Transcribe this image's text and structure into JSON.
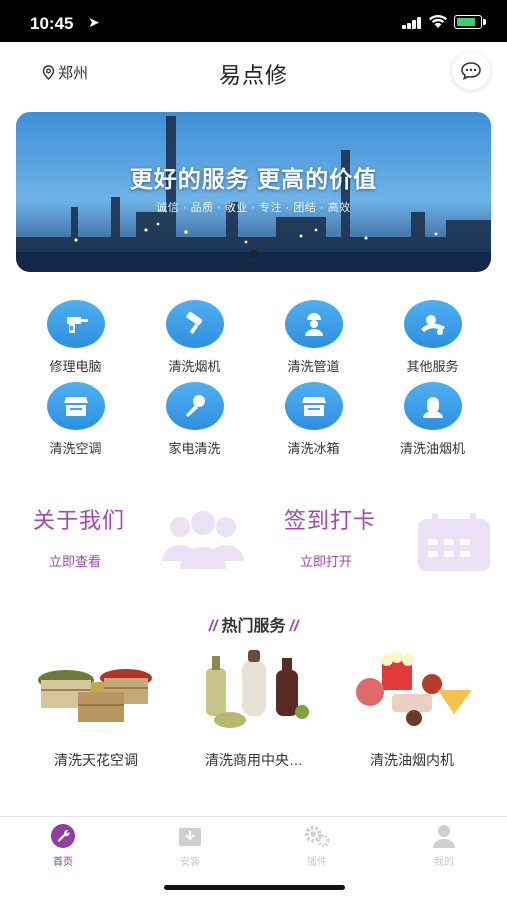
{
  "status_bar": {
    "time": "10:45",
    "location_arrow": "➤",
    "battery_color": "#3cd070"
  },
  "header": {
    "location": "郑州",
    "title": "易点修",
    "location_icon": "location-pin-icon",
    "message_icon": "chat-bubble-icon"
  },
  "banner": {
    "title": "更好的服务  更高的价值",
    "subtitle": "诚信 · 品质 · 敬业 · 专注 · 团结 · 高效",
    "active_dot": 1,
    "dot_count": 1
  },
  "services": [
    {
      "label": "修理电脑",
      "icon": "drill-icon"
    },
    {
      "label": "清洗烟机",
      "icon": "paint-roller-icon"
    },
    {
      "label": "清洗管道",
      "icon": "worker-icon"
    },
    {
      "label": "其他服务",
      "icon": "delivery-person-icon"
    },
    {
      "label": "清洗空调",
      "icon": "storefront-icon"
    },
    {
      "label": "家电清洗",
      "icon": "microphone-icon"
    },
    {
      "label": "清洗冰箱",
      "icon": "storefront-icon"
    },
    {
      "label": "清洗油烟机",
      "icon": "person-icon"
    }
  ],
  "promos": [
    {
      "title": "关于我们",
      "link": "立即查看",
      "icon": "group-people-icon"
    },
    {
      "title": "签到打卡",
      "link": "立即打开",
      "icon": "calendar-icon"
    }
  ],
  "hot_section": {
    "title": "热门服务",
    "decor": "//"
  },
  "hot_services": [
    {
      "label": "清洗天花空调",
      "image": "grain-bowls-image"
    },
    {
      "label": "清洗商用中央…",
      "image": "bottles-image"
    },
    {
      "label": "清洗油烟内机",
      "image": "snacks-image"
    }
  ],
  "tabs": [
    {
      "label": "首页",
      "icon": "wrench-icon",
      "active": true
    },
    {
      "label": "安装",
      "icon": "download-box-icon",
      "active": false
    },
    {
      "label": "插件",
      "icon": "gears-icon",
      "active": false
    },
    {
      "label": "我的",
      "icon": "user-icon",
      "active": false
    }
  ],
  "colors": {
    "accent": "#a547b6",
    "icon_blue": "#3a9be6",
    "tab_active": "#8e3fa0"
  }
}
